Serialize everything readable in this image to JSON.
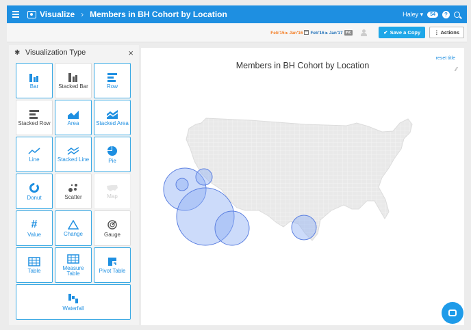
{
  "header": {
    "app_name": "Visualize",
    "separator": "›",
    "page_title": "Members in BH Cohort by Location",
    "user": "Haley ▾",
    "notifications": "54"
  },
  "toolbar": {
    "range_a": "Feb'15 ▸ Jan'16",
    "range_b": "Feb'16 ▸ Jan'17",
    "inc": "INC",
    "save_label": "Save a Copy",
    "actions_label": "Actions"
  },
  "panel": {
    "title": "Visualization Type",
    "tiles": [
      {
        "label": "Bar"
      },
      {
        "label": "Stacked Bar"
      },
      {
        "label": "Row"
      },
      {
        "label": "Stacked Row"
      },
      {
        "label": "Area"
      },
      {
        "label": "Stacked Area"
      },
      {
        "label": "Line"
      },
      {
        "label": "Stacked Line"
      },
      {
        "label": "Pie"
      },
      {
        "label": "Donut"
      },
      {
        "label": "Scatter"
      },
      {
        "label": "Map"
      },
      {
        "label": "Value"
      },
      {
        "label": "Change"
      },
      {
        "label": "Gauge"
      },
      {
        "label": "Table"
      },
      {
        "label": "Measure Table"
      },
      {
        "label": "Pivot Table"
      },
      {
        "label": "Waterfall"
      }
    ]
  },
  "chart": {
    "title": "Members in BH Cohort by Location",
    "reset_label": "reset title"
  },
  "colors": {
    "accent": "#1e8fe1",
    "bubble_fill": "#8fb0f5",
    "bubble_stroke": "#5b7fe0"
  }
}
